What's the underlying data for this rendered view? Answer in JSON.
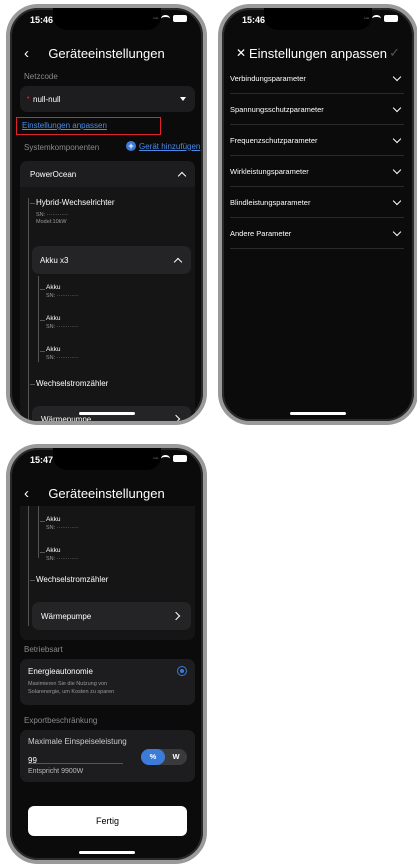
{
  "phone1": {
    "time": "15:46",
    "title": "Geräteeinstellungen",
    "back_icon": "chevron-left-icon",
    "netzcode_label": "Netzcode",
    "netzcode_value": "null-null",
    "adjust_link": "Einstellungen anpassen",
    "system_label": "Systemkomponenten",
    "add_device": "Gerät hinzufügen",
    "powerocean": "PowerOcean",
    "inverter_name": "Hybrid-Wechselrichter",
    "inverter_sn": "SN: ············",
    "inverter_model": "Model:10kW",
    "akku_group": "Akku x3",
    "akkus": [
      {
        "name": "Akku",
        "sn": "SN: ············"
      },
      {
        "name": "Akku",
        "sn": "SN: ············"
      },
      {
        "name": "Akku",
        "sn": "SN: ············"
      }
    ],
    "meter": "Wechselstromzähler",
    "heatpump": "Wärmepumpe"
  },
  "phone2": {
    "time": "15:46",
    "title": "Einstellungen anpassen",
    "close_icon": "close-icon",
    "check_icon": "check-icon",
    "params": [
      "Verbindungsparameter",
      "Spannungsschutzparameter",
      "Frequenzschutzparameter",
      "Wirkleistungsparameter",
      "Blindleistungsparameter",
      "Andere Parameter"
    ]
  },
  "phone3": {
    "time": "15:47",
    "title": "Geräteeinstellungen",
    "akkus": [
      {
        "name": "Akku",
        "sn": "SN: ············"
      },
      {
        "name": "Akku",
        "sn": "SN: ············"
      }
    ],
    "meter": "Wechselstromzähler",
    "heatpump": "Wärmepumpe",
    "mode_label": "Betriebsart",
    "mode_title": "Energieautonomie",
    "mode_desc_1": "Maximieren Sie die Nutzung von",
    "mode_desc_2": "Solarenergie, um Kosten zu sparen",
    "export_label": "Exportbeschränkung",
    "max_feed_label": "Maximale Einspeiseleistung",
    "max_feed_value": "99",
    "unit_percent": "%",
    "unit_watt": "W",
    "equivalent": "Entspricht 9900W",
    "done_button": "Fertig"
  },
  "colors": {
    "accent_blue": "#3d7bd9",
    "highlight_red": "#e0222a",
    "card_bg": "#1d1d1f",
    "screen_bg": "#0b0b0b"
  }
}
